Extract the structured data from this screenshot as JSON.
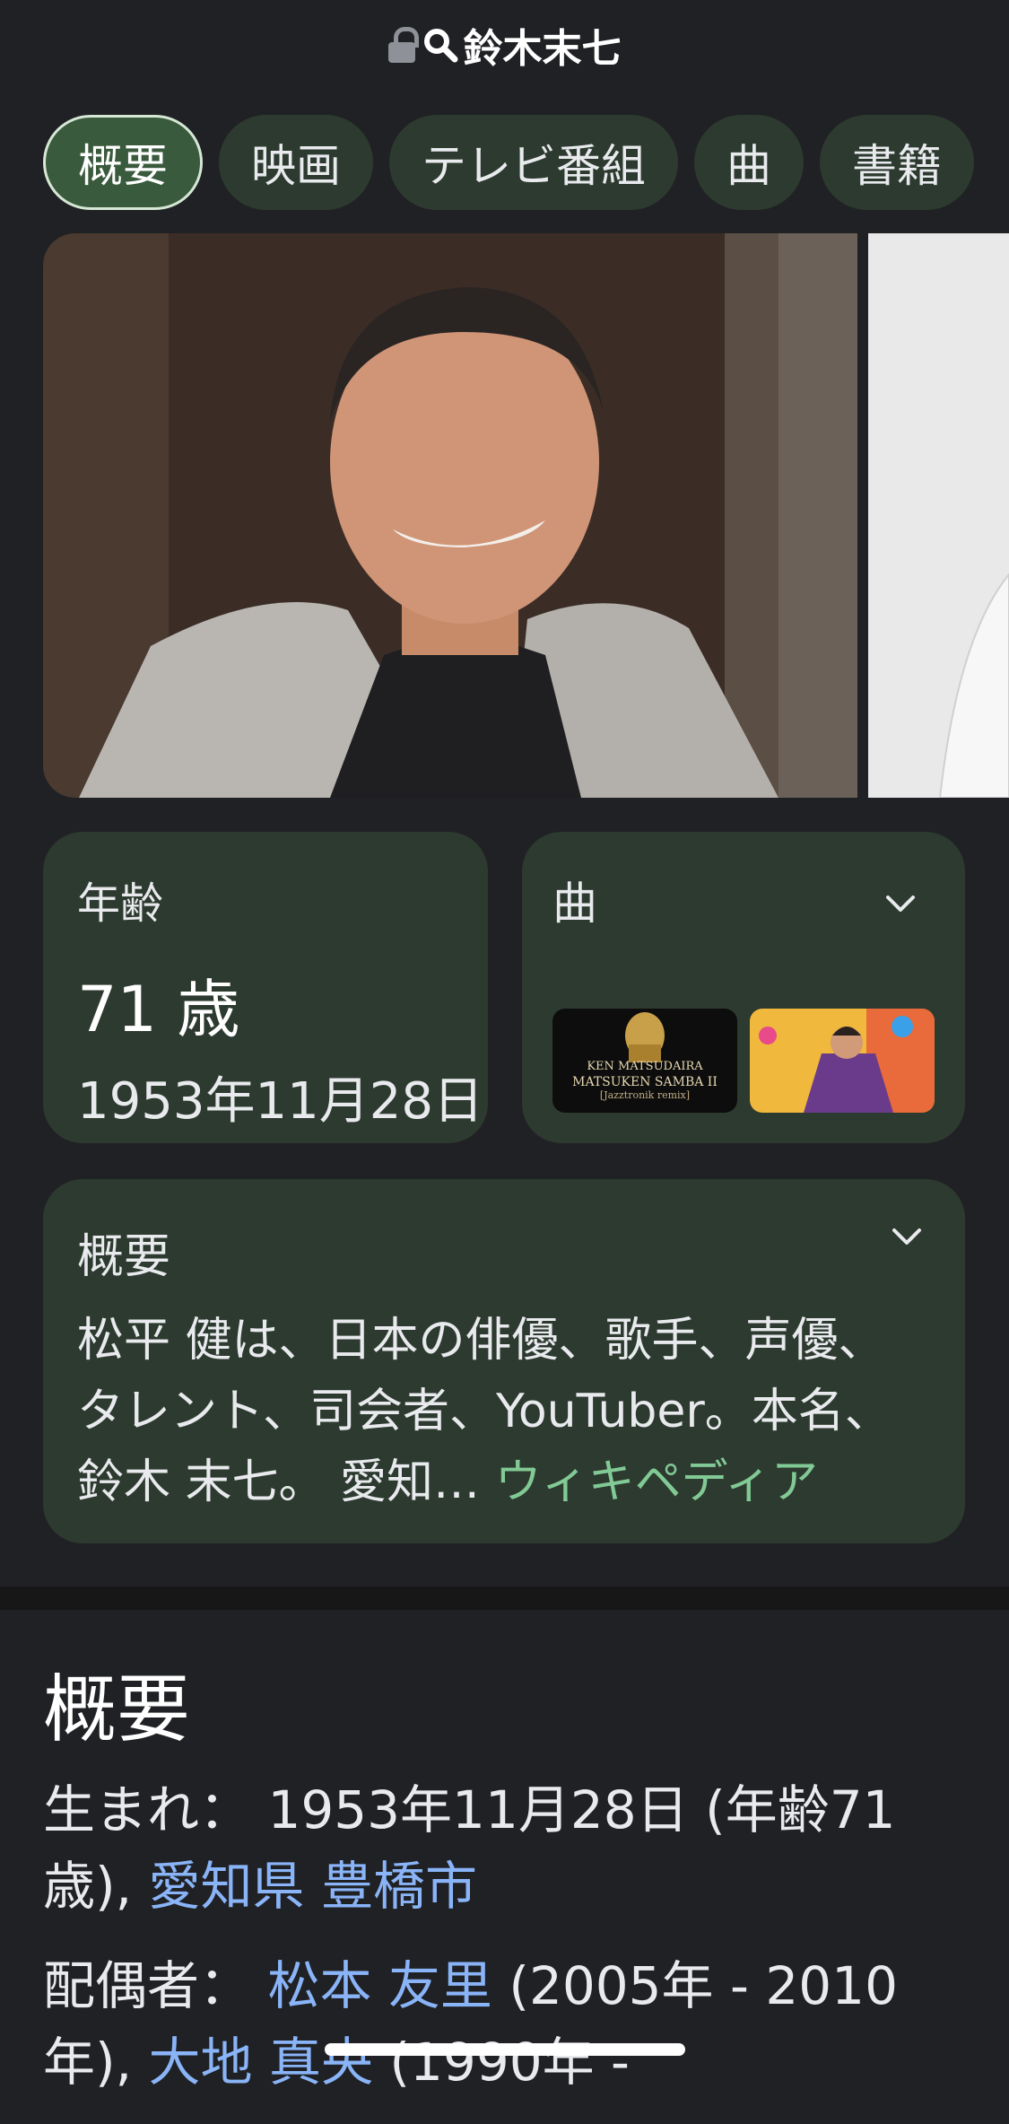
{
  "header": {
    "title": "鈴木末七",
    "lock_icon": "lock-icon",
    "search_icon": "search-icon"
  },
  "tabs": [
    {
      "label": "概要",
      "active": true
    },
    {
      "label": "映画"
    },
    {
      "label": "テレビ番組"
    },
    {
      "label": "曲"
    },
    {
      "label": "書籍"
    }
  ],
  "age_card": {
    "label": "年齢",
    "value": "71 歳",
    "birth": "1953年11月28日"
  },
  "songs_card": {
    "label": "曲",
    "album1_line1": "KEN MATSUDAIRA",
    "album1_line2": "MATSUKEN SAMBA II",
    "album1_line3": "[Jazztronik remix]"
  },
  "summary_card": {
    "label": "概要",
    "text": "松平 健は、日本の俳優、歌手、声優、タレント、司会者、YouTuber。本名、鈴木 末七。 愛知…",
    "source": "ウィキペディア"
  },
  "overview": {
    "title": "概要",
    "born_label": "生まれ：",
    "born_value": "1953年11月28日 (年齢71歳),",
    "born_place": "愛知県 豊橋市",
    "spouse_label": "配偶者：",
    "spouse1": "松本 友里",
    "spouse1_years": "(2005年 - 2010年),",
    "spouse2": "大地 真央",
    "spouse2_years": "(1990年 -"
  },
  "colors": {
    "background": "#202124",
    "card": "#2d3a2f",
    "accent_green": "#81c995",
    "link_blue": "#8ab4f8"
  }
}
